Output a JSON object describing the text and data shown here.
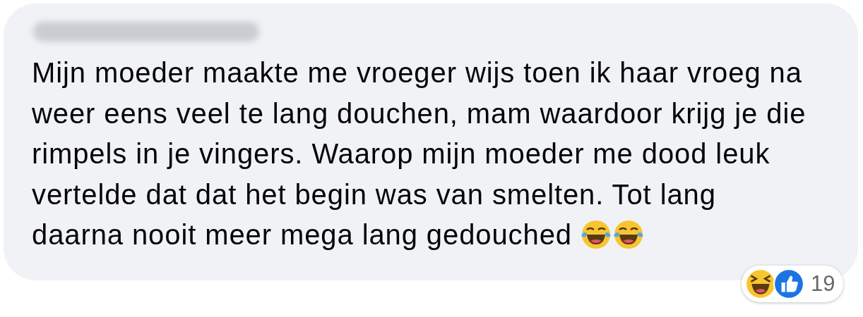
{
  "comment": {
    "author_blurred": true,
    "lines": [
      "Mijn moeder maakte me vroeger wijs toen ik haar vroeg na",
      "weer eens veel te lang douchen, mam waardoor krijg je die",
      "rimpels in je vingers. Waarop mijn moeder me dood leuk",
      "vertelde dat dat het begin was van smelten. Tot lang",
      "daarna nooit meer mega lang gedouched"
    ],
    "trailing_emojis": [
      {
        "kind": "tears-of-joy"
      },
      {
        "kind": "tears-of-joy"
      }
    ],
    "reactions": {
      "icons": [
        {
          "kind": "haha"
        },
        {
          "kind": "like"
        }
      ],
      "count": "19"
    }
  }
}
